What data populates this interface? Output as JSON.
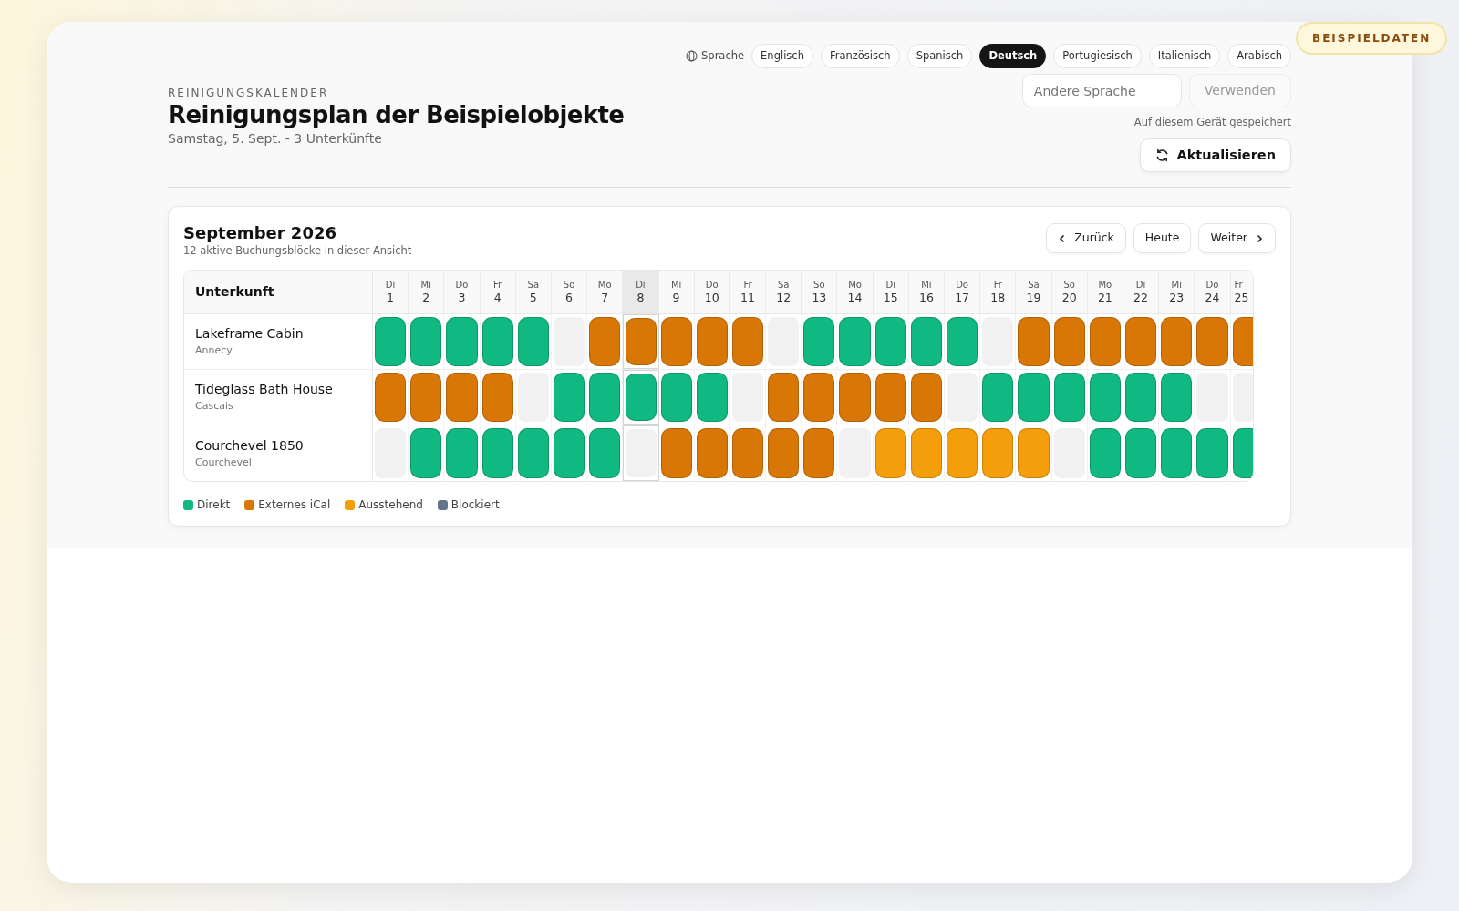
{
  "badge": "BEISPIELDATEN",
  "language": {
    "label": "Sprache",
    "options": [
      {
        "label": "Englisch",
        "selected": false
      },
      {
        "label": "Französisch",
        "selected": false
      },
      {
        "label": "Spanisch",
        "selected": false
      },
      {
        "label": "Deutsch",
        "selected": true
      },
      {
        "label": "Portugiesisch",
        "selected": false
      },
      {
        "label": "Italienisch",
        "selected": false
      },
      {
        "label": "Arabisch",
        "selected": false
      }
    ],
    "custom": {
      "placeholder": "Andere Sprache"
    },
    "apply_button": {
      "label": "Verwenden",
      "disabled": true
    },
    "note": "Auf diesem Gerät gespeichert"
  },
  "header": {
    "eyebrow": "REINIGUNGSKALENDER",
    "title": "Reinigungsplan der Beispielobjekte",
    "subtitle": "Samstag, 5. Sept. - 3 Unterkünfte",
    "refresh_button": "Aktualisieren"
  },
  "calendar": {
    "title": "September 2026",
    "subtitle": "12 aktive Buchungsblöcke in dieser Ansicht",
    "nav": {
      "prev": "Zurück",
      "today": "Heute",
      "next": "Weiter"
    },
    "column_header": "Unterkunft",
    "days": [
      {
        "weekday": "Di",
        "day": "1",
        "today": false
      },
      {
        "weekday": "Mi",
        "day": "2",
        "today": false
      },
      {
        "weekday": "Do",
        "day": "3",
        "today": false
      },
      {
        "weekday": "Fr",
        "day": "4",
        "today": false
      },
      {
        "weekday": "Sa",
        "day": "5",
        "today": false
      },
      {
        "weekday": "So",
        "day": "6",
        "today": false
      },
      {
        "weekday": "Mo",
        "day": "7",
        "today": false
      },
      {
        "weekday": "Di",
        "day": "8",
        "today": true
      },
      {
        "weekday": "Mi",
        "day": "9",
        "today": false
      },
      {
        "weekday": "Do",
        "day": "10",
        "today": false
      },
      {
        "weekday": "Fr",
        "day": "11",
        "today": false
      },
      {
        "weekday": "Sa",
        "day": "12",
        "today": false
      },
      {
        "weekday": "So",
        "day": "13",
        "today": false
      },
      {
        "weekday": "Mo",
        "day": "14",
        "today": false
      },
      {
        "weekday": "Di",
        "day": "15",
        "today": false
      },
      {
        "weekday": "Mi",
        "day": "16",
        "today": false
      },
      {
        "weekday": "Do",
        "day": "17",
        "today": false
      },
      {
        "weekday": "Fr",
        "day": "18",
        "today": false
      },
      {
        "weekday": "Sa",
        "day": "19",
        "today": false
      },
      {
        "weekday": "So",
        "day": "20",
        "today": false
      },
      {
        "weekday": "Mo",
        "day": "21",
        "today": false
      },
      {
        "weekday": "Di",
        "day": "22",
        "today": false
      },
      {
        "weekday": "Mi",
        "day": "23",
        "today": false
      },
      {
        "weekday": "Do",
        "day": "24",
        "today": false
      },
      {
        "weekday": "Fr",
        "day": "25",
        "today": false
      }
    ],
    "properties": [
      {
        "name": "Lakeframe Cabin",
        "location": "Annecy",
        "cells": [
          {
            "kind": "direkt"
          },
          {
            "kind": "direkt"
          },
          {
            "kind": "direkt"
          },
          {
            "kind": "direkt"
          },
          {
            "kind": "direkt"
          },
          {
            "kind": "frei"
          },
          {
            "kind": "extern"
          },
          {
            "kind": "extern"
          },
          {
            "kind": "extern"
          },
          {
            "kind": "extern"
          },
          {
            "kind": "extern"
          },
          {
            "kind": "frei"
          },
          {
            "kind": "direkt"
          },
          {
            "kind": "direkt"
          },
          {
            "kind": "direkt"
          },
          {
            "kind": "direkt"
          },
          {
            "kind": "direkt"
          },
          {
            "kind": "frei"
          },
          {
            "kind": "extern"
          },
          {
            "kind": "extern"
          },
          {
            "kind": "extern"
          },
          {
            "kind": "extern"
          },
          {
            "kind": "extern"
          },
          {
            "kind": "extern"
          },
          {
            "kind": "extern"
          }
        ]
      },
      {
        "name": "Tideglass Bath House",
        "location": "Cascais",
        "cells": [
          {
            "kind": "extern"
          },
          {
            "kind": "extern"
          },
          {
            "kind": "extern"
          },
          {
            "kind": "extern"
          },
          {
            "kind": "frei"
          },
          {
            "kind": "direkt"
          },
          {
            "kind": "direkt"
          },
          {
            "kind": "direkt"
          },
          {
            "kind": "direkt"
          },
          {
            "kind": "direkt"
          },
          {
            "kind": "frei"
          },
          {
            "kind": "extern"
          },
          {
            "kind": "extern"
          },
          {
            "kind": "extern"
          },
          {
            "kind": "extern"
          },
          {
            "kind": "extern"
          },
          {
            "kind": "frei"
          },
          {
            "kind": "direkt"
          },
          {
            "kind": "direkt"
          },
          {
            "kind": "direkt"
          },
          {
            "kind": "direkt"
          },
          {
            "kind": "direkt"
          },
          {
            "kind": "direkt"
          },
          {
            "kind": "frei"
          },
          {
            "kind": "frei"
          }
        ]
      },
      {
        "name": "Courchevel 1850",
        "location": "Courchevel",
        "cells": [
          {
            "kind": "frei"
          },
          {
            "kind": "direkt"
          },
          {
            "kind": "direkt"
          },
          {
            "kind": "direkt"
          },
          {
            "kind": "direkt"
          },
          {
            "kind": "direkt"
          },
          {
            "kind": "direkt"
          },
          {
            "kind": "frei"
          },
          {
            "kind": "extern"
          },
          {
            "kind": "extern"
          },
          {
            "kind": "extern"
          },
          {
            "kind": "extern"
          },
          {
            "kind": "extern"
          },
          {
            "kind": "frei"
          },
          {
            "kind": "ausstehend"
          },
          {
            "kind": "ausstehend"
          },
          {
            "kind": "ausstehend"
          },
          {
            "kind": "ausstehend"
          },
          {
            "kind": "ausstehend"
          },
          {
            "kind": "frei"
          },
          {
            "kind": "direkt"
          },
          {
            "kind": "direkt"
          },
          {
            "kind": "direkt"
          },
          {
            "kind": "direkt"
          },
          {
            "kind": "direkt"
          }
        ]
      }
    ],
    "legend": [
      {
        "kind": "direkt",
        "label": "Direkt",
        "color": "#10b981"
      },
      {
        "kind": "extern",
        "label": "Externes iCal",
        "color": "#d97706"
      },
      {
        "kind": "ausstehend",
        "label": "Ausstehend",
        "color": "#f59e0b"
      },
      {
        "kind": "blockiert",
        "label": "Blockiert",
        "color": "#64748b"
      }
    ]
  }
}
